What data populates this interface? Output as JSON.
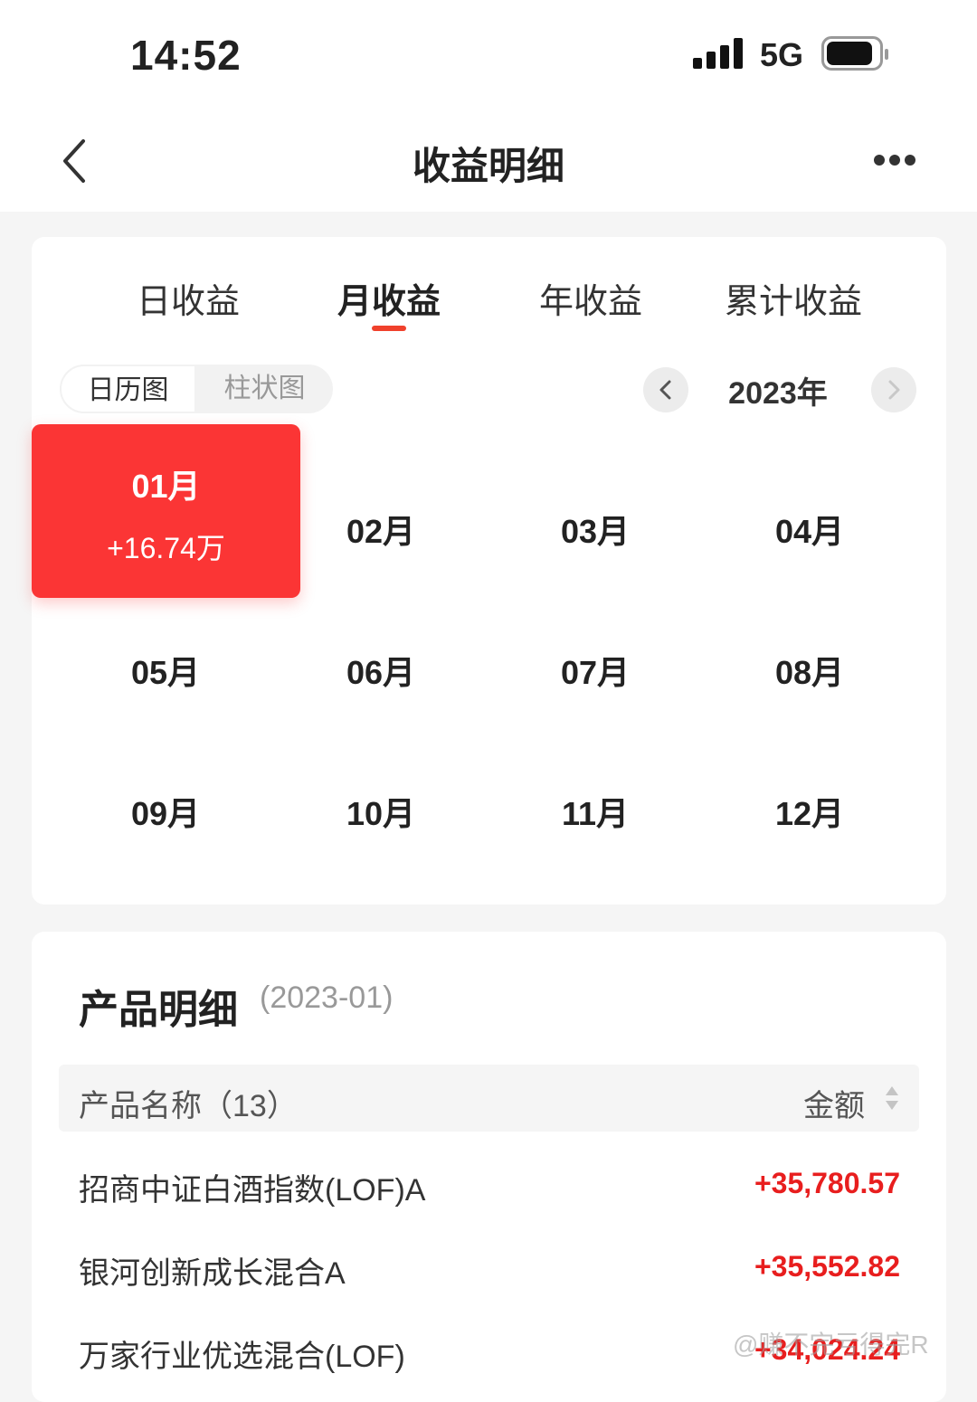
{
  "status": {
    "time": "14:52",
    "network": "5G"
  },
  "nav": {
    "title": "收益明细"
  },
  "tabs": [
    {
      "label": "日收益"
    },
    {
      "label": "月收益"
    },
    {
      "label": "年收益"
    },
    {
      "label": "累计收益"
    }
  ],
  "view_toggle": {
    "calendar": "日历图",
    "bar": "柱状图"
  },
  "year": "2023年",
  "months": [
    {
      "label": "01月",
      "amount": "+16.74万"
    },
    {
      "label": "02月"
    },
    {
      "label": "03月"
    },
    {
      "label": "04月"
    },
    {
      "label": "05月"
    },
    {
      "label": "06月"
    },
    {
      "label": "07月"
    },
    {
      "label": "08月"
    },
    {
      "label": "09月"
    },
    {
      "label": "10月"
    },
    {
      "label": "11月"
    },
    {
      "label": "12月"
    }
  ],
  "detail": {
    "title": "产品明细",
    "period": "(2023-01)",
    "header_name": "产品名称（13）",
    "header_amount": "金额",
    "rows": [
      {
        "name": "招商中证白酒指数(LOF)A",
        "amount": "+35,780.57"
      },
      {
        "name": "银河创新成长混合A",
        "amount": "+35,552.82"
      },
      {
        "name": "万家行业优选混合(LOF)",
        "amount": "+34,024.24"
      }
    ]
  },
  "watermark": "@赚不完亏得完R",
  "colors": {
    "accent": "#fb3535",
    "tab_underline": "#f0412c",
    "positive": "#e81e1e"
  }
}
